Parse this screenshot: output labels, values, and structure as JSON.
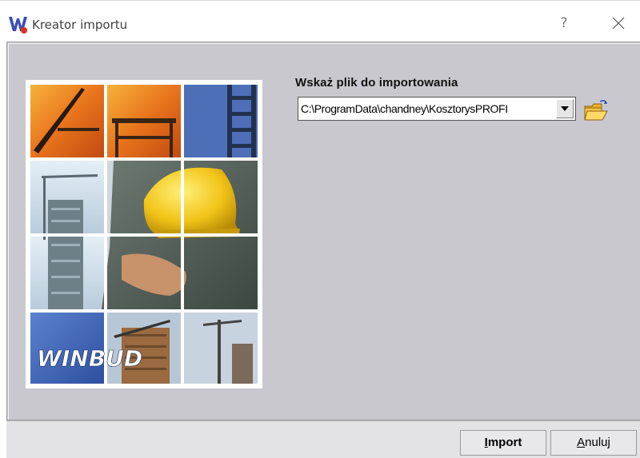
{
  "window": {
    "title": "Kreator importu",
    "help_symbol": "?"
  },
  "illustration": {
    "brand_text": "WINBUD"
  },
  "form": {
    "file_label": "Wskaż plik do importowania",
    "file_path_value": "C:\\ProgramData\\chandney\\KosztorysPROFI",
    "browse_icon": "folder-open-icon"
  },
  "buttons": {
    "import_accel": "I",
    "import_rest": "mport",
    "cancel_accel": "A",
    "cancel_rest": "nuluj"
  },
  "colors": {
    "client_bg": "#c9c8cf",
    "brand_blue": "#3a5cb0",
    "helmet_yellow": "#f2c418"
  }
}
